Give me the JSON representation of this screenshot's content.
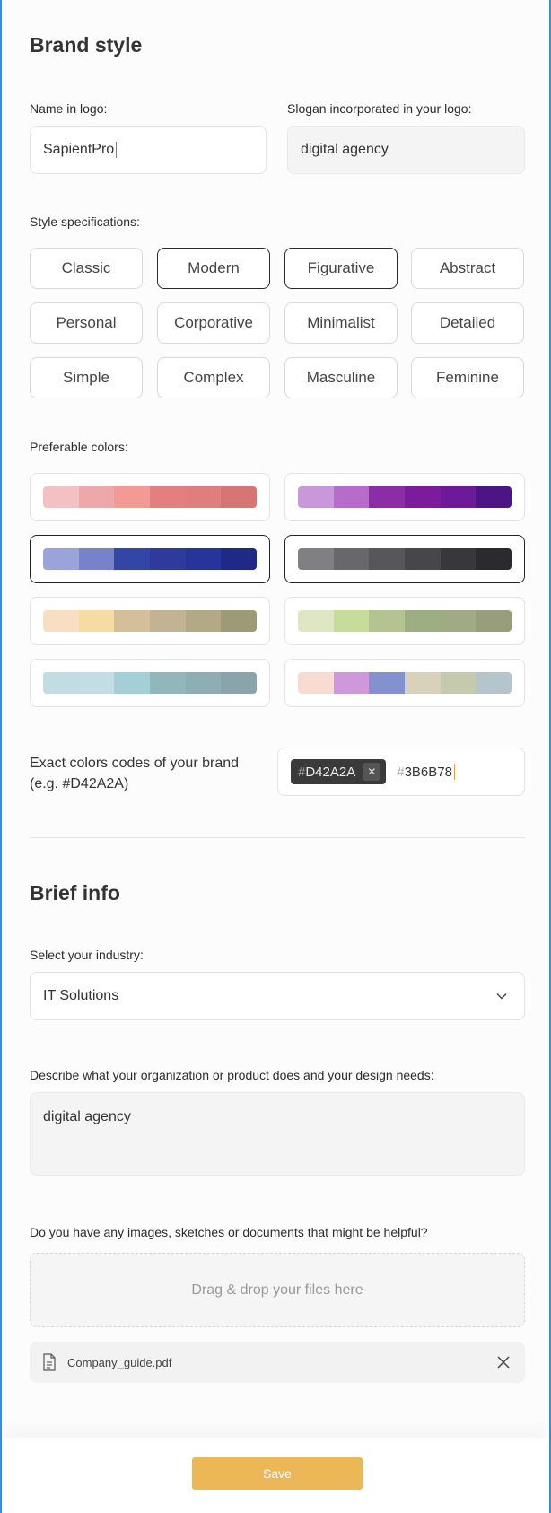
{
  "brand_style": {
    "title": "Brand style",
    "name_label": "Name in logo:",
    "name_value": "SapientPro",
    "slogan_label": "Slogan incorporated in your logo:",
    "slogan_value": "digital agency",
    "style_label": "Style specifications:",
    "styles": [
      {
        "label": "Classic",
        "selected": false
      },
      {
        "label": "Modern",
        "selected": true
      },
      {
        "label": "Figurative",
        "selected": true
      },
      {
        "label": "Abstract",
        "selected": false
      },
      {
        "label": "Personal",
        "selected": false
      },
      {
        "label": "Corporative",
        "selected": false
      },
      {
        "label": "Minimalist",
        "selected": false
      },
      {
        "label": "Detailed",
        "selected": false
      },
      {
        "label": "Simple",
        "selected": false
      },
      {
        "label": "Complex",
        "selected": false
      },
      {
        "label": "Masculine",
        "selected": false
      },
      {
        "label": "Feminine",
        "selected": false
      }
    ],
    "colors_label": "Preferable colors:",
    "palettes": [
      {
        "selected": false,
        "colors": [
          "#f4c1c3",
          "#eda9aa",
          "#f39a95",
          "#e57f7f",
          "#df7e7d",
          "#d77474"
        ]
      },
      {
        "selected": false,
        "colors": [
          "#c998db",
          "#b86cc9",
          "#8a2da6",
          "#7c1c9d",
          "#6c1a9a",
          "#4d1485"
        ]
      },
      {
        "selected": true,
        "colors": [
          "#9ba3db",
          "#7882cb",
          "#3445a8",
          "#2f3b9c",
          "#27359a",
          "#1e2a85"
        ]
      },
      {
        "selected": true,
        "colors": [
          "#808083",
          "#68686c",
          "#57575b",
          "#47474b",
          "#38383c",
          "#2b2b2f"
        ]
      },
      {
        "selected": false,
        "colors": [
          "#f7dfc4",
          "#f6dba2",
          "#d3c09a",
          "#c2b394",
          "#b4a987",
          "#9d9a77"
        ]
      },
      {
        "selected": false,
        "colors": [
          "#dfe6c3",
          "#c6dc9a",
          "#b4c390",
          "#9dae83",
          "#a0ab86",
          "#989d7c"
        ]
      },
      {
        "selected": false,
        "colors": [
          "#c1dce3",
          "#c2dde4",
          "#a4cfd6",
          "#93b5bc",
          "#8eaeb5",
          "#89a5ab"
        ]
      },
      {
        "selected": false,
        "colors": [
          "#f8dcd2",
          "#cf98da",
          "#8392cf",
          "#d8d1bc",
          "#c5caae",
          "#b5c5cc"
        ]
      }
    ],
    "exact_colors_label": "Exact colors codes of your brand (e.g. #D42A2A)",
    "color_tags": [
      {
        "hash": "#",
        "code": "D42A2A"
      }
    ],
    "color_input": {
      "hash": "#",
      "code": "3B6B78"
    }
  },
  "brief_info": {
    "title": "Brief info",
    "industry_label": "Select your industry:",
    "industry_value": "IT Solutions",
    "describe_label": "Describe what your organization or product does and your design needs:",
    "describe_value": "digital agency",
    "files_label": "Do you have any images, sketches or documents that might be helpful?",
    "dropzone_text": "Drag & drop your files here",
    "file_name": "Company_guide.pdf"
  },
  "footer": {
    "save_label": "Save",
    "accent": "#ecb757"
  }
}
